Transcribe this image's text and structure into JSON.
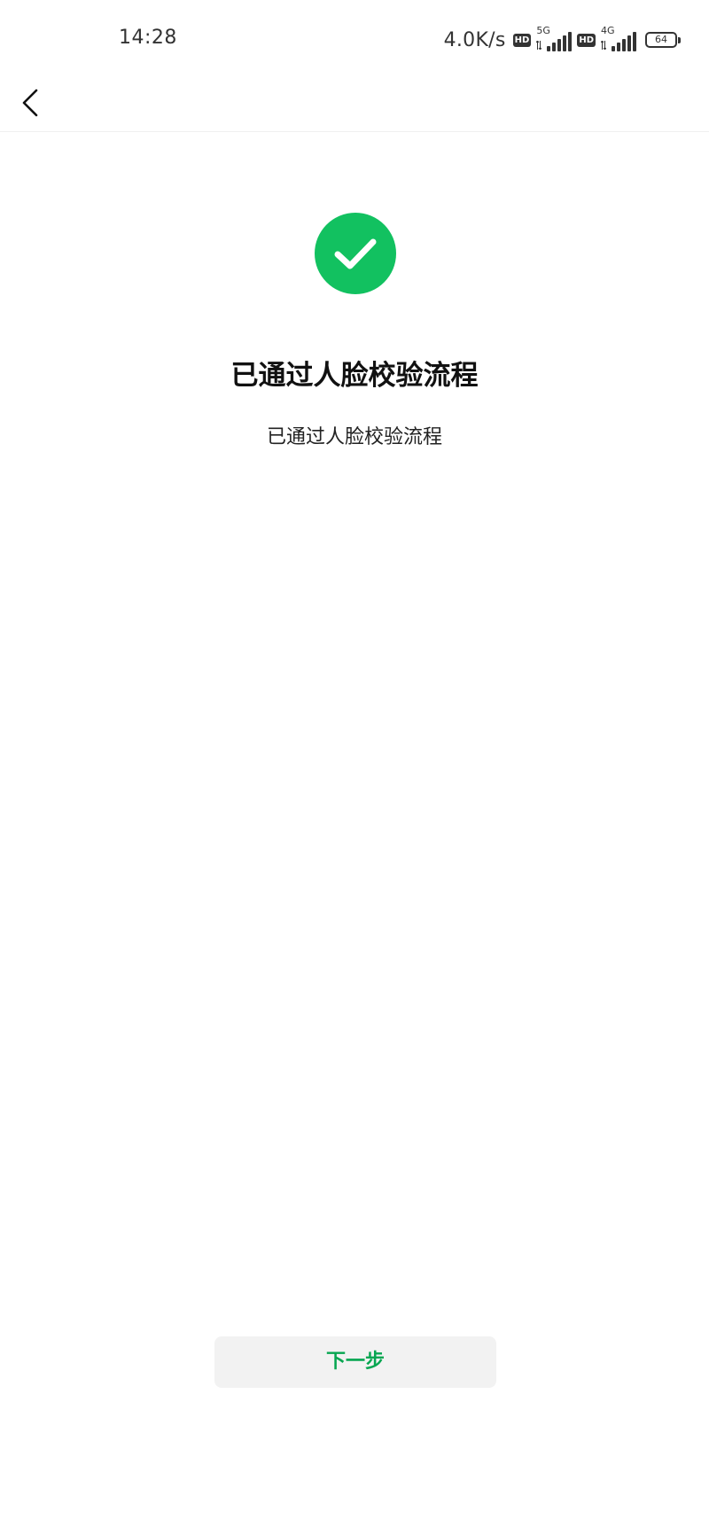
{
  "status_bar": {
    "time": "14:28",
    "net_speed": "4.0K/s",
    "hd_label": "HD",
    "network_1": "5G",
    "network_2": "4G",
    "battery_level": "64"
  },
  "nav": {
    "back_icon": "chevron-left-icon"
  },
  "result": {
    "icon": "check-circle-icon",
    "icon_color": "#12c160",
    "title": "已通过人脸校验流程",
    "description": "已通过人脸校验流程"
  },
  "footer": {
    "next_label": "下一步",
    "accent_color": "#07a651"
  }
}
